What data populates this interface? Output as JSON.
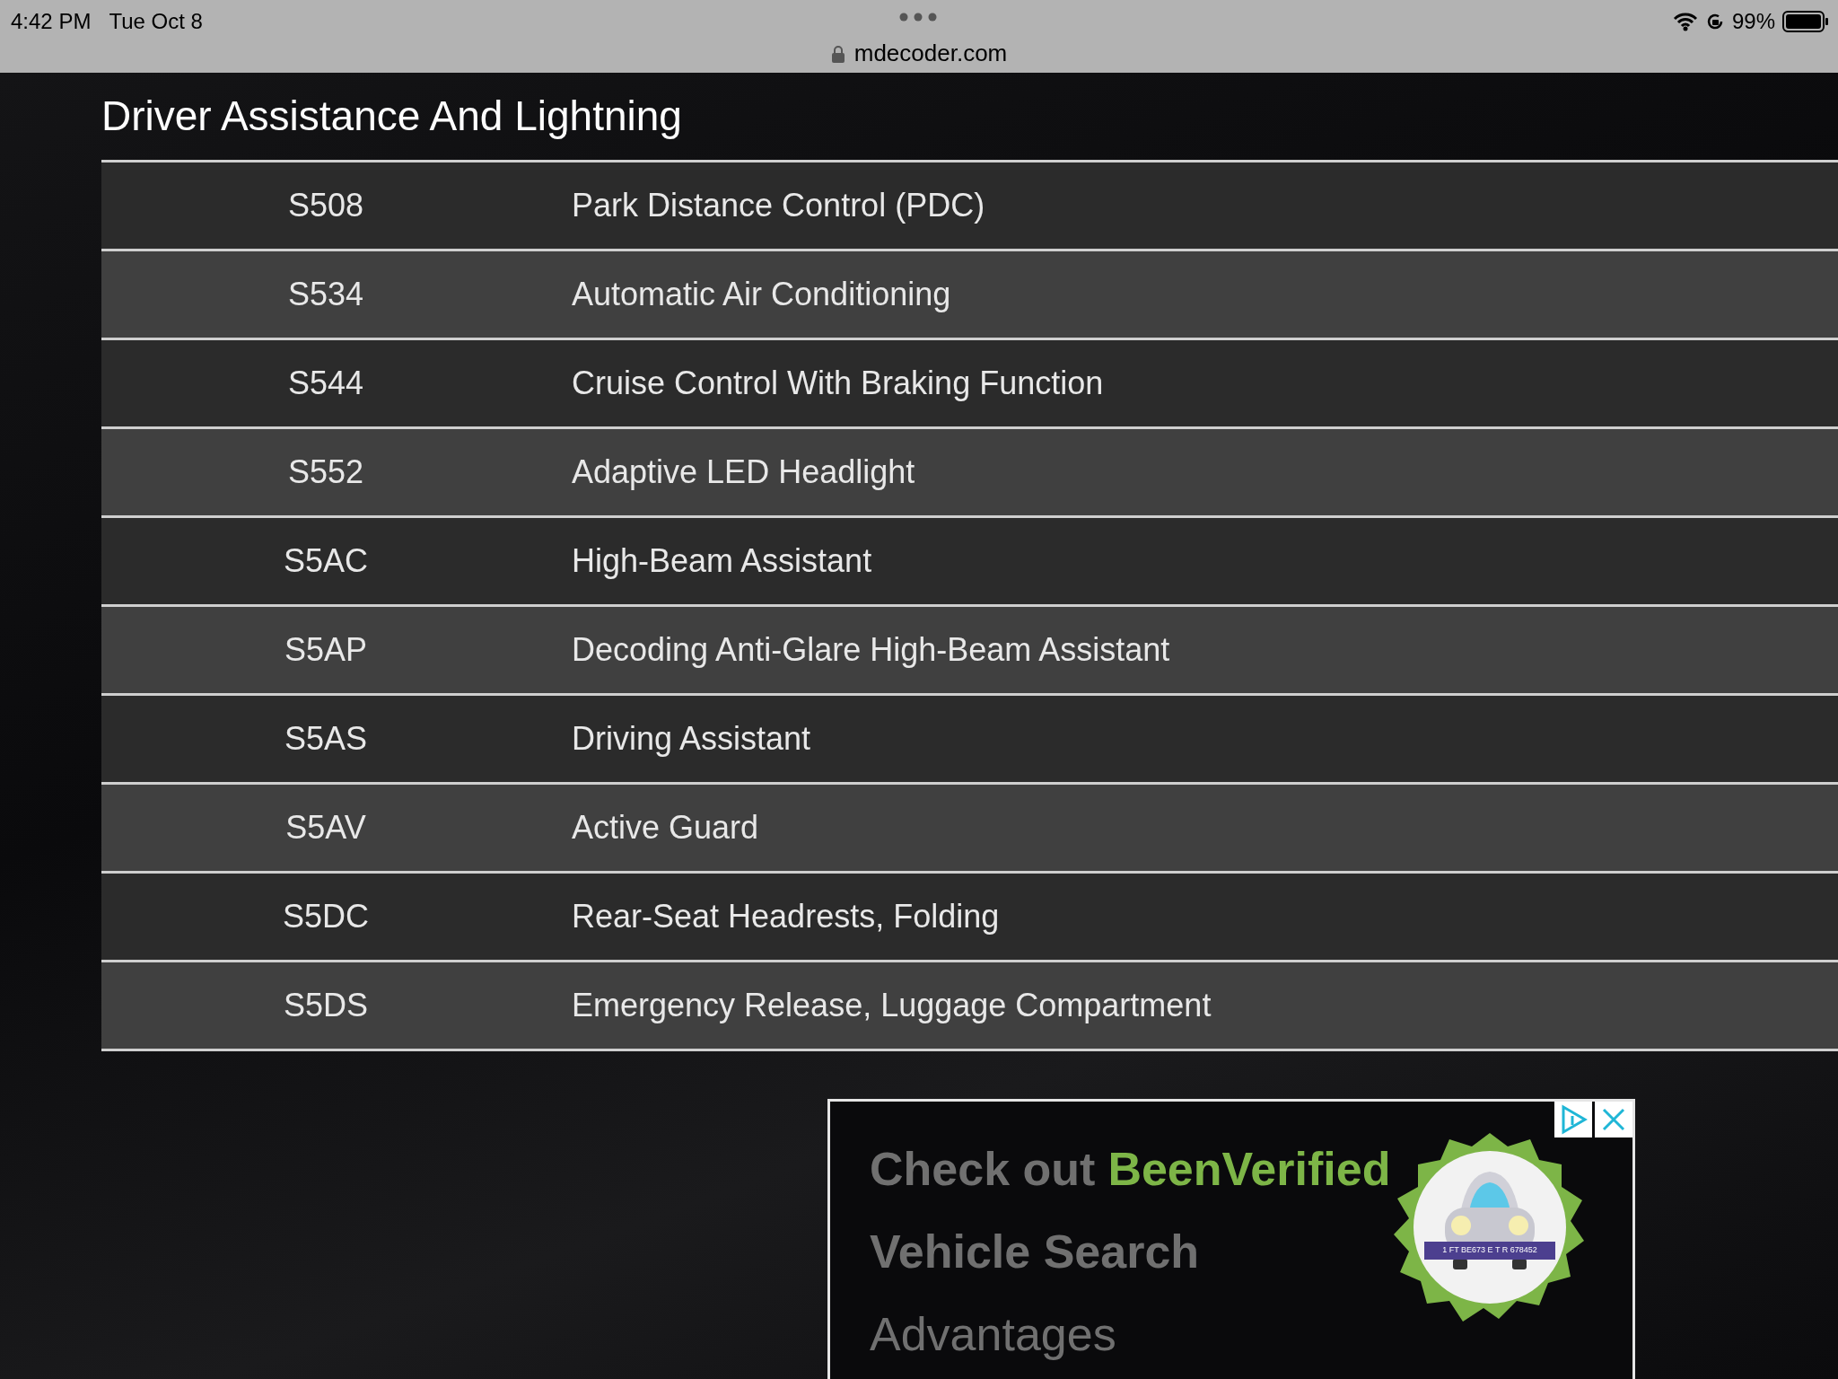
{
  "status_bar": {
    "time": "4:42 PM",
    "date": "Tue Oct 8",
    "battery": "99%"
  },
  "address_bar": {
    "url": "mdecoder.com"
  },
  "section": {
    "title": "Driver Assistance And Lightning"
  },
  "table": {
    "rows": [
      {
        "code": "S508",
        "description": "Park Distance Control (PDC)"
      },
      {
        "code": "S534",
        "description": "Automatic Air Conditioning"
      },
      {
        "code": "S544",
        "description": "Cruise Control With Braking Function"
      },
      {
        "code": "S552",
        "description": "Adaptive LED Headlight"
      },
      {
        "code": "S5AC",
        "description": "High-Beam Assistant"
      },
      {
        "code": "S5AP",
        "description": "Decoding Anti-Glare High-Beam Assistant"
      },
      {
        "code": "S5AS",
        "description": "Driving Assistant"
      },
      {
        "code": "S5AV",
        "description": "Active Guard"
      },
      {
        "code": "S5DC",
        "description": "Rear-Seat Headrests, Folding"
      },
      {
        "code": "S5DS",
        "description": "Emergency Release, Luggage Compartment"
      }
    ]
  },
  "ad": {
    "headline_prefix": "Check out",
    "brand": "BeenVerified",
    "headline_rest": "Vehicle Search",
    "subline": "Advantages",
    "plate": "1 FT BE673 E T R 678452"
  }
}
